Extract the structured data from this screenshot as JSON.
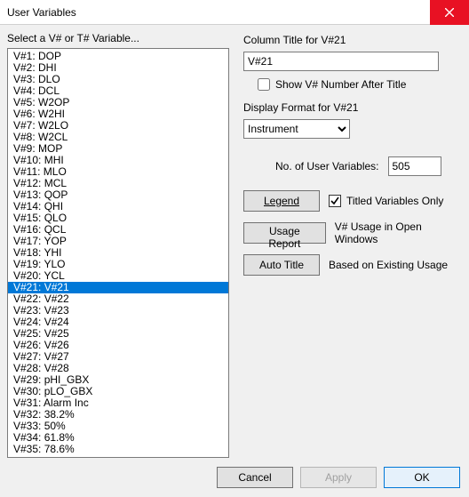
{
  "window": {
    "title": "User Variables"
  },
  "left": {
    "label": "Select a V# or T# Variable...",
    "items": [
      "V#1: DOP",
      "V#2: DHI",
      "V#3: DLO",
      "V#4: DCL",
      "V#5: W2OP",
      "V#6: W2HI",
      "V#7: W2LO",
      "V#8: W2CL",
      "V#9: MOP",
      "V#10: MHI",
      "V#11: MLO",
      "V#12: MCL",
      "V#13: QOP",
      "V#14: QHI",
      "V#15: QLO",
      "V#16: QCL",
      "V#17: YOP",
      "V#18: YHI",
      "V#19: YLO",
      "V#20: YCL",
      "V#21: V#21",
      "V#22: V#22",
      "V#23: V#23",
      "V#24: V#24",
      "V#25: V#25",
      "V#26: V#26",
      "V#27: V#27",
      "V#28: V#28",
      "V#29: pHI_GBX",
      "V#30: pLO_GBX",
      "V#31: Alarm Inc",
      "V#32: 38.2%",
      "V#33: 50%",
      "V#34: 61.8%",
      "V#35: 78.6%"
    ],
    "selected_index": 20
  },
  "right": {
    "column_title_label": "Column Title for V#21",
    "column_title_value": "V#21",
    "show_num_checkbox_label": "Show V# Number After Title",
    "show_num_checked": false,
    "display_format_label": "Display Format for V#21",
    "display_format_value": "Instrument",
    "num_vars_label": "No. of User Variables:",
    "num_vars_value": "505",
    "legend_btn": "Legend",
    "titled_only_label": "Titled Variables Only",
    "titled_only_checked": true,
    "usage_btn": "Usage Report",
    "usage_text": "V# Usage in Open Windows",
    "autotitle_btn": "Auto Title",
    "autotitle_text": "Based on Existing Usage"
  },
  "bottom": {
    "cancel": "Cancel",
    "apply": "Apply",
    "ok": "OK"
  }
}
